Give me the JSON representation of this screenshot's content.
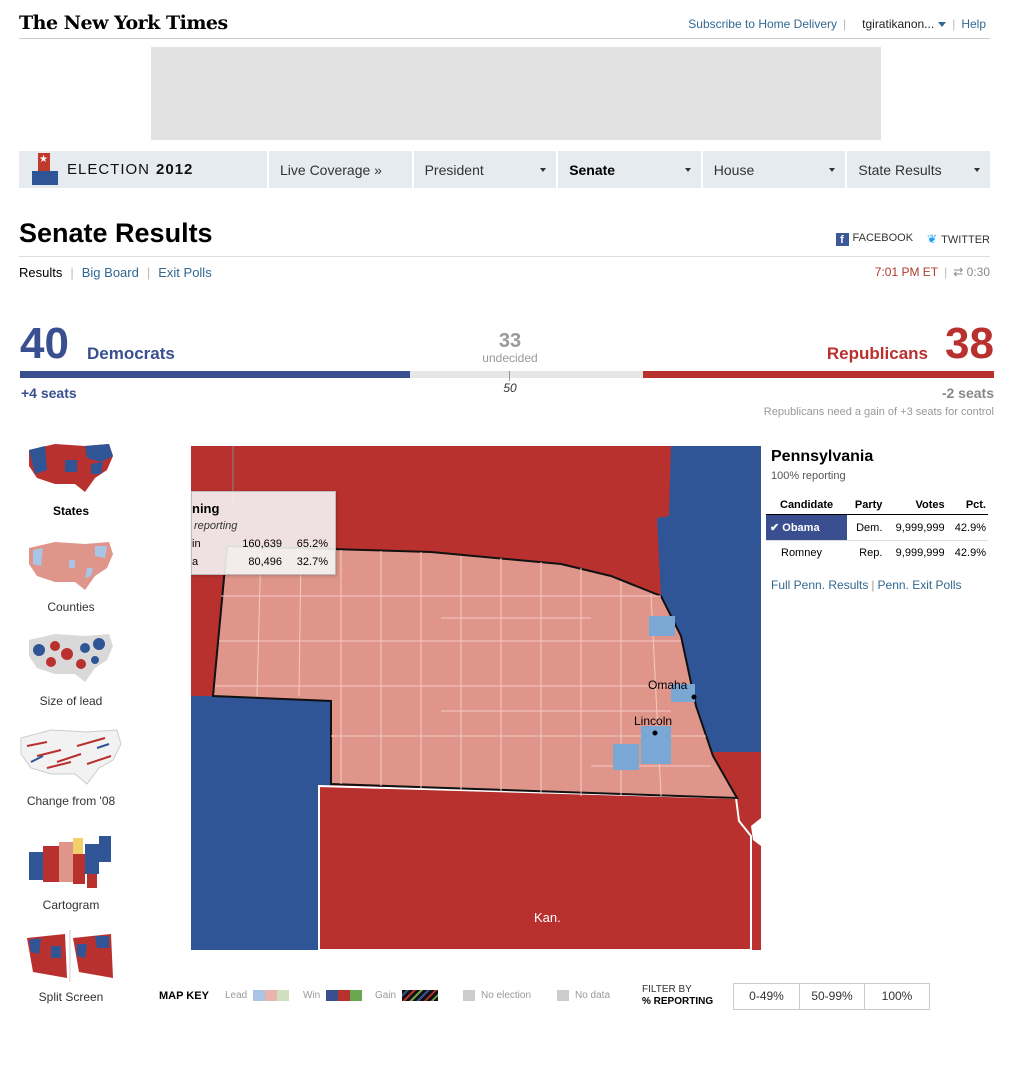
{
  "masthead": {
    "logo": "The New York Times",
    "subscribe": "Subscribe to Home Delivery",
    "user": "tgiratikanon...",
    "help": "Help"
  },
  "nav": {
    "brand_prefix": "ELECTION",
    "brand_year": "2012",
    "items": [
      {
        "label": "Live Coverage »",
        "has_caret": false,
        "active": false
      },
      {
        "label": "President",
        "has_caret": true,
        "active": false
      },
      {
        "label": "Senate",
        "has_caret": true,
        "active": true
      },
      {
        "label": "House",
        "has_caret": true,
        "active": false
      },
      {
        "label": "State Results",
        "has_caret": true,
        "active": false
      }
    ]
  },
  "page": {
    "title": "Senate Results",
    "share": {
      "facebook": "FACEBOOK",
      "twitter": "TWITTER"
    },
    "subnav": {
      "results": "Results",
      "big_board": "Big Board",
      "exit_polls": "Exit Polls"
    },
    "time": "7:01 PM ET",
    "refresh": "0:30"
  },
  "seats": {
    "dem_count": "40",
    "dem_label": "Democrats",
    "undecided_count": "33",
    "undecided_label": "undecided",
    "rep_count": "38",
    "rep_label": "Republicans",
    "midpoint": "50",
    "dem_change": "+4 seats",
    "rep_change": "-2 seats",
    "control_note": "Republicans need a gain of +3 seats for control",
    "total": 100,
    "dem_value": 40,
    "rep_value": 36
  },
  "views": [
    {
      "label": "States",
      "active": true
    },
    {
      "label": "Counties",
      "active": false
    },
    {
      "label": "Size of lead",
      "active": false
    },
    {
      "label": "Change from '08",
      "active": false
    },
    {
      "label": "Cartogram",
      "active": false
    },
    {
      "label": "Split Screen",
      "active": false
    }
  ],
  "tooltip": {
    "title": "ning",
    "subtitle": "reporting",
    "rows": [
      {
        "name": "in",
        "votes": "160,639",
        "pct": "65.2%"
      },
      {
        "name": "a",
        "votes": "80,496",
        "pct": "32.7%"
      }
    ]
  },
  "map": {
    "cities": [
      "Omaha",
      "Lincoln"
    ],
    "state_label": "Kan."
  },
  "state_panel": {
    "name": "Pennsylvania",
    "reporting": "100% reporting",
    "headers": [
      "Candidate",
      "Party",
      "Votes",
      "Pct."
    ],
    "rows": [
      {
        "candidate": "Obama",
        "party": "Dem.",
        "votes": "9,999,999",
        "pct": "42.9%",
        "winner": true
      },
      {
        "candidate": "Romney",
        "party": "Rep.",
        "votes": "9,999,999",
        "pct": "42.9%",
        "winner": false
      }
    ],
    "link_results": "Full Penn. Results",
    "link_polls": "Penn. Exit Polls"
  },
  "map_key": {
    "title": "MAP KEY",
    "lead": "Lead",
    "win": "Win",
    "gain": "Gain",
    "no_election": "No election",
    "no_data": "No data",
    "filter_line1": "FILTER BY",
    "filter_line2": "% REPORTING",
    "filters": [
      "0-49%",
      "50-99%",
      "100%"
    ]
  },
  "colors": {
    "dem": "#3a4f8f",
    "rep": "#b8312f",
    "dem_lead": "#7ba7d4",
    "rep_lead": "#e0958a",
    "map_dem": "#2f5597",
    "map_rep": "#b8312f"
  }
}
